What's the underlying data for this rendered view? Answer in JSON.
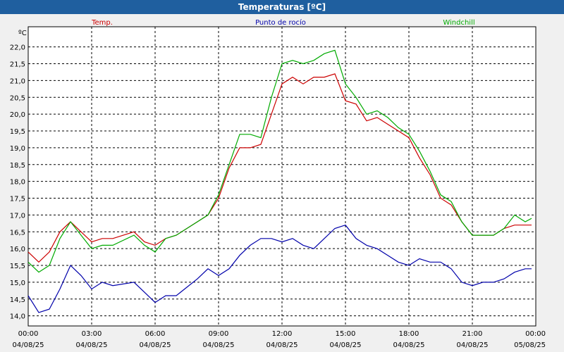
{
  "window": {
    "title": "Temperaturas [ºC]"
  },
  "chart_data": {
    "type": "line",
    "title": "Temperaturas [ºC]",
    "ylabel": "ºC",
    "xlabel": "",
    "ylim": [
      13.7,
      22.6
    ],
    "xlim": [
      0,
      24
    ],
    "grid": true,
    "legend": "top",
    "x_unit": "hours since 04/08/25 00:00",
    "y_ticks": [
      "14,0",
      "14,5",
      "15,0",
      "15,5",
      "16,0",
      "16,5",
      "17,0",
      "17,5",
      "18,0",
      "18,5",
      "19,0",
      "19,5",
      "20,0",
      "20,5",
      "21,0",
      "21,5",
      "22,0"
    ],
    "x_ticks": [
      {
        "time": "00:00",
        "date": "04/08/25"
      },
      {
        "time": "03:00",
        "date": "04/08/25"
      },
      {
        "time": "06:00",
        "date": "04/08/25"
      },
      {
        "time": "09:00",
        "date": "04/08/25"
      },
      {
        "time": "12:00",
        "date": "04/08/25"
      },
      {
        "time": "15:00",
        "date": "04/08/25"
      },
      {
        "time": "18:00",
        "date": "04/08/25"
      },
      {
        "time": "21:00",
        "date": "04/08/25"
      },
      {
        "time": "00:00",
        "date": "05/08/25"
      }
    ],
    "series": [
      {
        "name": "Temp.",
        "color": "#cc0000",
        "points": [
          [
            0,
            15.9
          ],
          [
            0.5,
            15.6
          ],
          [
            1,
            15.9
          ],
          [
            1.5,
            16.5
          ],
          [
            2,
            16.8
          ],
          [
            2.5,
            16.5
          ],
          [
            3,
            16.2
          ],
          [
            3.5,
            16.3
          ],
          [
            4,
            16.3
          ],
          [
            5,
            16.5
          ],
          [
            5.5,
            16.2
          ],
          [
            6,
            16.1
          ],
          [
            6.5,
            16.3
          ],
          [
            7,
            16.4
          ],
          [
            8,
            16.8
          ],
          [
            8.5,
            17.0
          ],
          [
            9,
            17.5
          ],
          [
            9.5,
            18.4
          ],
          [
            10,
            19.0
          ],
          [
            10.5,
            19.0
          ],
          [
            11,
            19.1
          ],
          [
            11.5,
            20.0
          ],
          [
            12,
            20.9
          ],
          [
            12.5,
            21.1
          ],
          [
            13,
            20.9
          ],
          [
            13.5,
            21.1
          ],
          [
            14,
            21.1
          ],
          [
            14.5,
            21.2
          ],
          [
            15,
            20.4
          ],
          [
            15.5,
            20.3
          ],
          [
            16,
            19.8
          ],
          [
            16.5,
            19.9
          ],
          [
            17,
            19.7
          ],
          [
            17.5,
            19.5
          ],
          [
            18,
            19.3
          ],
          [
            18.5,
            18.7
          ],
          [
            19,
            18.2
          ],
          [
            19.5,
            17.5
          ],
          [
            20,
            17.3
          ],
          [
            20.5,
            16.8
          ],
          [
            21,
            16.4
          ],
          [
            21.5,
            16.4
          ],
          [
            22,
            16.4
          ],
          [
            22.5,
            16.6
          ],
          [
            23,
            16.7
          ],
          [
            23.5,
            16.7
          ],
          [
            23.8,
            16.7
          ]
        ]
      },
      {
        "name": "Punto de rocío",
        "color": "#0000aa",
        "points": [
          [
            0,
            14.6
          ],
          [
            0.5,
            14.1
          ],
          [
            1,
            14.2
          ],
          [
            1.5,
            14.8
          ],
          [
            2,
            15.5
          ],
          [
            2.5,
            15.2
          ],
          [
            3,
            14.8
          ],
          [
            3.5,
            15.0
          ],
          [
            4,
            14.9
          ],
          [
            5,
            15.0
          ],
          [
            5.5,
            14.7
          ],
          [
            6,
            14.4
          ],
          [
            6.5,
            14.6
          ],
          [
            7,
            14.6
          ],
          [
            8,
            15.1
          ],
          [
            8.5,
            15.4
          ],
          [
            9,
            15.2
          ],
          [
            9.5,
            15.4
          ],
          [
            10,
            15.8
          ],
          [
            10.5,
            16.1
          ],
          [
            11,
            16.3
          ],
          [
            11.5,
            16.3
          ],
          [
            12,
            16.2
          ],
          [
            12.5,
            16.3
          ],
          [
            13,
            16.1
          ],
          [
            13.5,
            16.0
          ],
          [
            14,
            16.3
          ],
          [
            14.5,
            16.6
          ],
          [
            15,
            16.7
          ],
          [
            15.5,
            16.3
          ],
          [
            16,
            16.1
          ],
          [
            16.5,
            16.0
          ],
          [
            17,
            15.8
          ],
          [
            17.5,
            15.6
          ],
          [
            18,
            15.5
          ],
          [
            18.5,
            15.7
          ],
          [
            19,
            15.6
          ],
          [
            19.5,
            15.6
          ],
          [
            20,
            15.4
          ],
          [
            20.5,
            15.0
          ],
          [
            21,
            14.9
          ],
          [
            21.5,
            15.0
          ],
          [
            22,
            15.0
          ],
          [
            22.5,
            15.1
          ],
          [
            23,
            15.3
          ],
          [
            23.5,
            15.4
          ],
          [
            23.8,
            15.4
          ]
        ]
      },
      {
        "name": "Windchill",
        "color": "#00aa00",
        "points": [
          [
            0,
            15.6
          ],
          [
            0.5,
            15.3
          ],
          [
            1,
            15.5
          ],
          [
            1.5,
            16.3
          ],
          [
            2,
            16.8
          ],
          [
            2.5,
            16.4
          ],
          [
            3,
            16.0
          ],
          [
            3.5,
            16.1
          ],
          [
            4,
            16.1
          ],
          [
            5,
            16.4
          ],
          [
            5.5,
            16.1
          ],
          [
            6,
            15.9
          ],
          [
            6.5,
            16.3
          ],
          [
            7,
            16.4
          ],
          [
            8,
            16.8
          ],
          [
            8.5,
            17.0
          ],
          [
            9,
            17.6
          ],
          [
            9.5,
            18.5
          ],
          [
            10,
            19.4
          ],
          [
            10.5,
            19.4
          ],
          [
            11,
            19.3
          ],
          [
            11.5,
            20.5
          ],
          [
            12,
            21.5
          ],
          [
            12.5,
            21.6
          ],
          [
            13,
            21.5
          ],
          [
            13.5,
            21.6
          ],
          [
            14,
            21.8
          ],
          [
            14.5,
            21.9
          ],
          [
            15,
            20.9
          ],
          [
            15.5,
            20.5
          ],
          [
            16,
            20.0
          ],
          [
            16.5,
            20.1
          ],
          [
            17,
            19.9
          ],
          [
            17.5,
            19.6
          ],
          [
            18,
            19.4
          ],
          [
            18.5,
            18.9
          ],
          [
            19,
            18.3
          ],
          [
            19.5,
            17.6
          ],
          [
            20,
            17.4
          ],
          [
            20.5,
            16.8
          ],
          [
            21,
            16.4
          ],
          [
            21.5,
            16.4
          ],
          [
            22,
            16.4
          ],
          [
            22.5,
            16.6
          ],
          [
            23,
            17.0
          ],
          [
            23.5,
            16.8
          ],
          [
            23.8,
            16.9
          ]
        ]
      }
    ]
  }
}
